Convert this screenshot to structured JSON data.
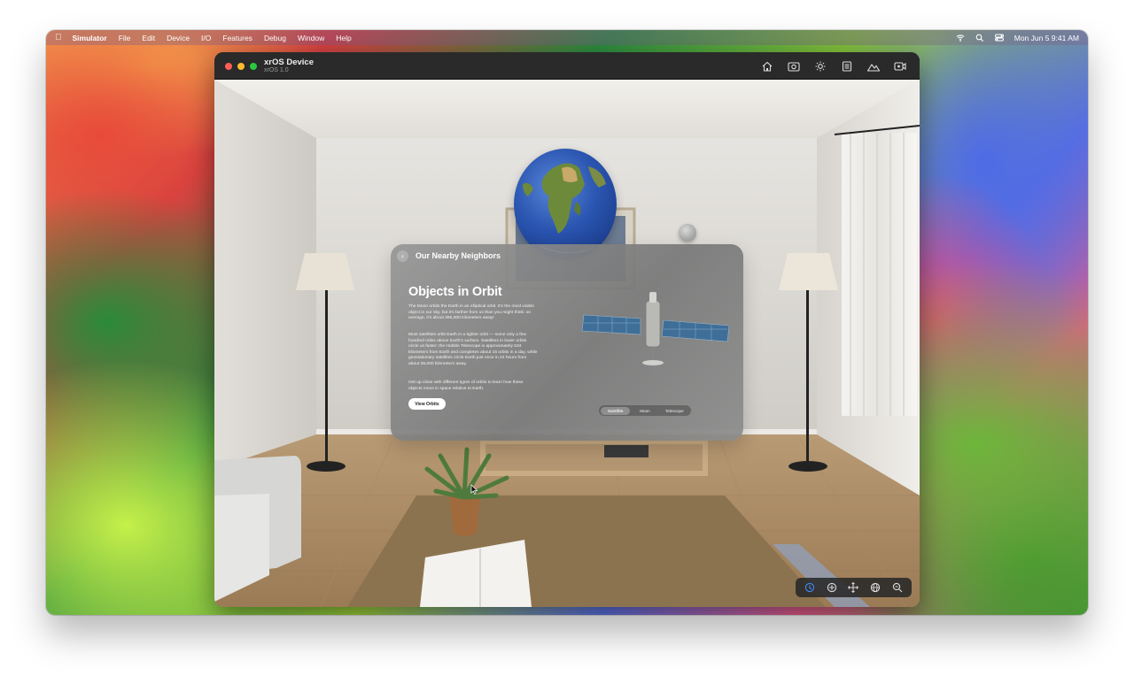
{
  "menubar": {
    "app_name": "Simulator",
    "items": [
      "File",
      "Edit",
      "Device",
      "I/O",
      "Features",
      "Debug",
      "Window",
      "Help"
    ],
    "datetime": "Mon Jun 5  9:41 AM",
    "status_icons": [
      "wifi-icon",
      "search-icon",
      "control-center-icon"
    ]
  },
  "window": {
    "title": "xrOS Device",
    "subtitle": "xrOS 1.0",
    "toolbar_icons": [
      "home-icon",
      "screenshot-icon",
      "brightness-icon",
      "keyboard-icon",
      "environment-icon",
      "record-icon"
    ]
  },
  "panel": {
    "nav_title": "Our Nearby Neighbors",
    "heading": "Objects in Orbit",
    "paragraph_1": "The Moon orbits the Earth in an elliptical orbit. It's the most visible object in our sky, but it's farther from us than you might think: on average, it's about 385,000 kilometers away!",
    "paragraph_2": "Most satellites orbit Earth in a tighter orbit — some only a few hundred miles above Earth's surface. Satellites in lower orbits circle us faster: the Hubble Telescope is approximately 534 kilometers from Earth and completes about 15 orbits in a day, while geostationary satellites circle Earth just once in 24 hours from about 36,000 kilometers away.",
    "paragraph_3": "Get up close with different types of orbits to learn how these objects move in space relative to Earth.",
    "button_label": "View Orbits",
    "segments": [
      "Satellite",
      "Moon",
      "Telescope"
    ],
    "selected_segment": "Satellite"
  },
  "bottom_controls": [
    "look-icon",
    "interact-icon",
    "pan-icon",
    "orbit-icon",
    "zoom-icon"
  ],
  "colors": {
    "accent": "#3d8cff",
    "close": "#ff5f57",
    "minimize": "#febc2e",
    "zoom": "#28c840"
  }
}
